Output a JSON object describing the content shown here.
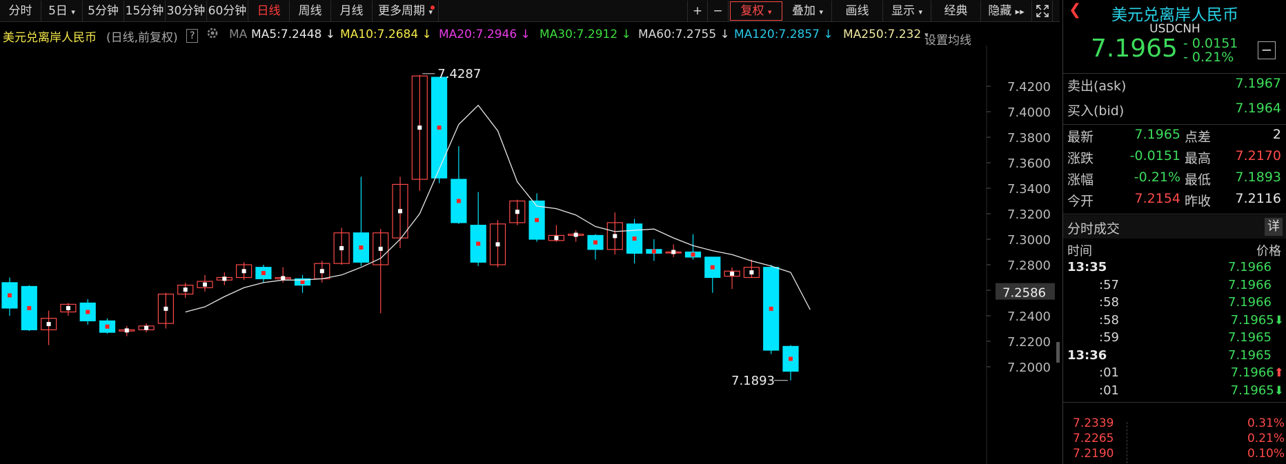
{
  "toolbar": {
    "left": [
      "分时",
      "5日",
      "5分钟",
      "15分钟",
      "30分钟",
      "60分钟",
      "日线",
      "周线",
      "月线",
      "更多周期"
    ],
    "active": "日线",
    "right": {
      "plus": "+",
      "minus": "−",
      "fuquan": "复权",
      "diejia": "叠加",
      "huaxian": "画线",
      "xianshi": "显示",
      "jingdian": "经典",
      "yincang": "隐藏"
    }
  },
  "infobar": {
    "name": "美元兑离岸人民币",
    "mode": "(日线,前复权)",
    "help": "?",
    "ma_label": "MA",
    "ma": [
      {
        "text": "MA5:7.2448",
        "arrow": "↓",
        "color": "#e8e8e8"
      },
      {
        "text": "MA10:7.2684",
        "arrow": "↓",
        "color": "#f5e94a"
      },
      {
        "text": "MA20:7.2946",
        "arrow": "↓",
        "color": "#e83ce8"
      },
      {
        "text": "MA30:7.2912",
        "arrow": "↓",
        "color": "#3ddc3d"
      },
      {
        "text": "MA60:7.2755",
        "arrow": "↓",
        "color": "#d8d8d8"
      },
      {
        "text": "MA120:7.2857",
        "arrow": "↓",
        "color": "#29c8e8"
      },
      {
        "text": "MA250:7.232",
        "arrow": "",
        "color": "#f0e8a0"
      }
    ],
    "settings": "设置均线"
  },
  "chart_data": {
    "type": "candlestick",
    "y_ticks": [
      "7.4200",
      "7.4000",
      "7.3800",
      "7.3600",
      "7.3400",
      "7.3200",
      "7.3000",
      "7.2800",
      "7.2600",
      "7.2400",
      "7.2200",
      "7.2000"
    ],
    "ylim": [
      7.19,
      7.44
    ],
    "current_price_label": "7.2586",
    "high_annotation": "7.4287",
    "low_annotation": "7.1893",
    "colors": {
      "up": "#ff4a4a",
      "down": "#00e5ff"
    },
    "candles": [
      {
        "o": 7.266,
        "c": 7.246,
        "h": 7.27,
        "l": 7.24
      },
      {
        "o": 7.263,
        "c": 7.229,
        "h": 7.264,
        "l": 7.228
      },
      {
        "o": 7.229,
        "c": 7.238,
        "h": 7.244,
        "l": 7.217
      },
      {
        "o": 7.243,
        "c": 7.249,
        "h": 7.25,
        "l": 7.24
      },
      {
        "o": 7.25,
        "c": 7.236,
        "h": 7.253,
        "l": 7.233
      },
      {
        "o": 7.236,
        "c": 7.227,
        "h": 7.238,
        "l": 7.226
      },
      {
        "o": 7.228,
        "c": 7.229,
        "h": 7.232,
        "l": 7.224
      },
      {
        "o": 7.229,
        "c": 7.232,
        "h": 7.234,
        "l": 7.227
      },
      {
        "o": 7.234,
        "c": 7.257,
        "h": 7.258,
        "l": 7.23
      },
      {
        "o": 7.257,
        "c": 7.264,
        "h": 7.266,
        "l": 7.254
      },
      {
        "o": 7.262,
        "c": 7.267,
        "h": 7.272,
        "l": 7.259
      },
      {
        "o": 7.268,
        "c": 7.27,
        "h": 7.274,
        "l": 7.264
      },
      {
        "o": 7.27,
        "c": 7.28,
        "h": 7.282,
        "l": 7.268
      },
      {
        "o": 7.278,
        "c": 7.269,
        "h": 7.28,
        "l": 7.266
      },
      {
        "o": 7.269,
        "c": 7.27,
        "h": 7.278,
        "l": 7.266
      },
      {
        "o": 7.269,
        "c": 7.264,
        "h": 7.272,
        "l": 7.258
      },
      {
        "o": 7.269,
        "c": 7.281,
        "h": 7.283,
        "l": 7.266
      },
      {
        "o": 7.281,
        "c": 7.305,
        "h": 7.309,
        "l": 7.28
      },
      {
        "o": 7.305,
        "c": 7.282,
        "h": 7.349,
        "l": 7.279
      },
      {
        "o": 7.28,
        "c": 7.305,
        "h": 7.308,
        "l": 7.242
      },
      {
        "o": 7.301,
        "c": 7.343,
        "h": 7.349,
        "l": 7.293
      },
      {
        "o": 7.347,
        "c": 7.428,
        "h": 7.4287,
        "l": 7.338
      },
      {
        "o": 7.427,
        "c": 7.348,
        "h": 7.427,
        "l": 7.344
      },
      {
        "o": 7.347,
        "c": 7.313,
        "h": 7.373,
        "l": 7.312
      },
      {
        "o": 7.311,
        "c": 7.282,
        "h": 7.337,
        "l": 7.279
      },
      {
        "o": 7.28,
        "c": 7.312,
        "h": 7.315,
        "l": 7.278
      },
      {
        "o": 7.313,
        "c": 7.33,
        "h": 7.331,
        "l": 7.311
      },
      {
        "o": 7.33,
        "c": 7.3,
        "h": 7.336,
        "l": 7.298
      },
      {
        "o": 7.299,
        "c": 7.303,
        "h": 7.311,
        "l": 7.298
      },
      {
        "o": 7.303,
        "c": 7.304,
        "h": 7.307,
        "l": 7.298
      },
      {
        "o": 7.303,
        "c": 7.292,
        "h": 7.304,
        "l": 7.284
      },
      {
        "o": 7.292,
        "c": 7.313,
        "h": 7.321,
        "l": 7.288
      },
      {
        "o": 7.312,
        "c": 7.289,
        "h": 7.316,
        "l": 7.281
      },
      {
        "o": 7.292,
        "c": 7.289,
        "h": 7.3,
        "l": 7.283
      },
      {
        "o": 7.29,
        "c": 7.29,
        "h": 7.296,
        "l": 7.286
      },
      {
        "o": 7.29,
        "c": 7.286,
        "h": 7.304,
        "l": 7.284
      },
      {
        "o": 7.286,
        "c": 7.27,
        "h": 7.286,
        "l": 7.258
      },
      {
        "o": 7.271,
        "c": 7.275,
        "h": 7.278,
        "l": 7.261
      },
      {
        "o": 7.27,
        "c": 7.278,
        "h": 7.284,
        "l": 7.27
      },
      {
        "o": 7.278,
        "c": 7.213,
        "h": 7.28,
        "l": 7.21
      },
      {
        "o": 7.216,
        "c": 7.1965,
        "h": 7.217,
        "l": 7.1893
      }
    ],
    "ma_lines": [
      {
        "name": "MA5",
        "color": "#e8e8e8",
        "start": 9,
        "values": [
          7.243,
          7.247,
          7.255,
          7.262,
          7.266,
          7.268,
          7.268,
          7.269,
          7.272,
          7.278,
          7.285,
          7.3,
          7.32,
          7.355,
          7.39,
          7.405,
          7.385,
          7.345,
          7.326,
          7.324,
          7.319,
          7.31,
          7.306,
          7.307,
          7.308,
          7.301,
          7.295,
          7.291,
          7.288,
          7.283,
          7.279,
          7.274,
          7.2448
        ]
      }
    ]
  },
  "panel": {
    "title": "美元兑离岸人民币",
    "code": "USDCNH",
    "price": "7.1965",
    "change": "- 0.0151",
    "change_pct": "- 0.21%",
    "collapse": "−",
    "ask_label": "卖出(ask)",
    "ask": "7.1967",
    "bid_label": "买入(bid)",
    "bid": "7.1964",
    "stats": [
      {
        "l1": "最新",
        "v1": "7.1965",
        "c1": "green",
        "l2": "点差",
        "v2": "2",
        "c2": "white"
      },
      {
        "l1": "涨跌",
        "v1": "-0.0151",
        "c1": "green",
        "l2": "最高",
        "v2": "7.2170",
        "c2": "red"
      },
      {
        "l1": "涨幅",
        "v1": "-0.21%",
        "c1": "green",
        "l2": "最低",
        "v2": "7.1893",
        "c2": "green"
      },
      {
        "l1": "今开",
        "v1": "7.2154",
        "c1": "red",
        "l2": "昨收",
        "v2": "7.2116",
        "c2": "white"
      }
    ],
    "trades_title": "分时成交",
    "trades_detail": "详",
    "col_time": "时间",
    "col_price": "价格",
    "trades": [
      {
        "t": "13:35",
        "bold": true,
        "p": "7.1966",
        "arrow": ""
      },
      {
        "t": ":57",
        "bold": false,
        "p": "7.1966",
        "arrow": ""
      },
      {
        "t": ":58",
        "bold": false,
        "p": "7.1966",
        "arrow": ""
      },
      {
        "t": ":58",
        "bold": false,
        "p": "7.1965",
        "arrow": "⬇"
      },
      {
        "t": ":59",
        "bold": false,
        "p": "7.1965",
        "arrow": ""
      },
      {
        "t": "13:36",
        "bold": true,
        "p": "7.1965",
        "arrow": ""
      },
      {
        "t": ":01",
        "bold": false,
        "p": "7.1966",
        "arrow": "⬆"
      },
      {
        "t": ":01",
        "bold": false,
        "p": "7.1965",
        "arrow": "⬇"
      }
    ],
    "mini_left": [
      "7.2339",
      "7.2265",
      "7.2190"
    ],
    "mini_right": [
      "0.31%",
      "0.21%",
      "0.10%"
    ]
  }
}
